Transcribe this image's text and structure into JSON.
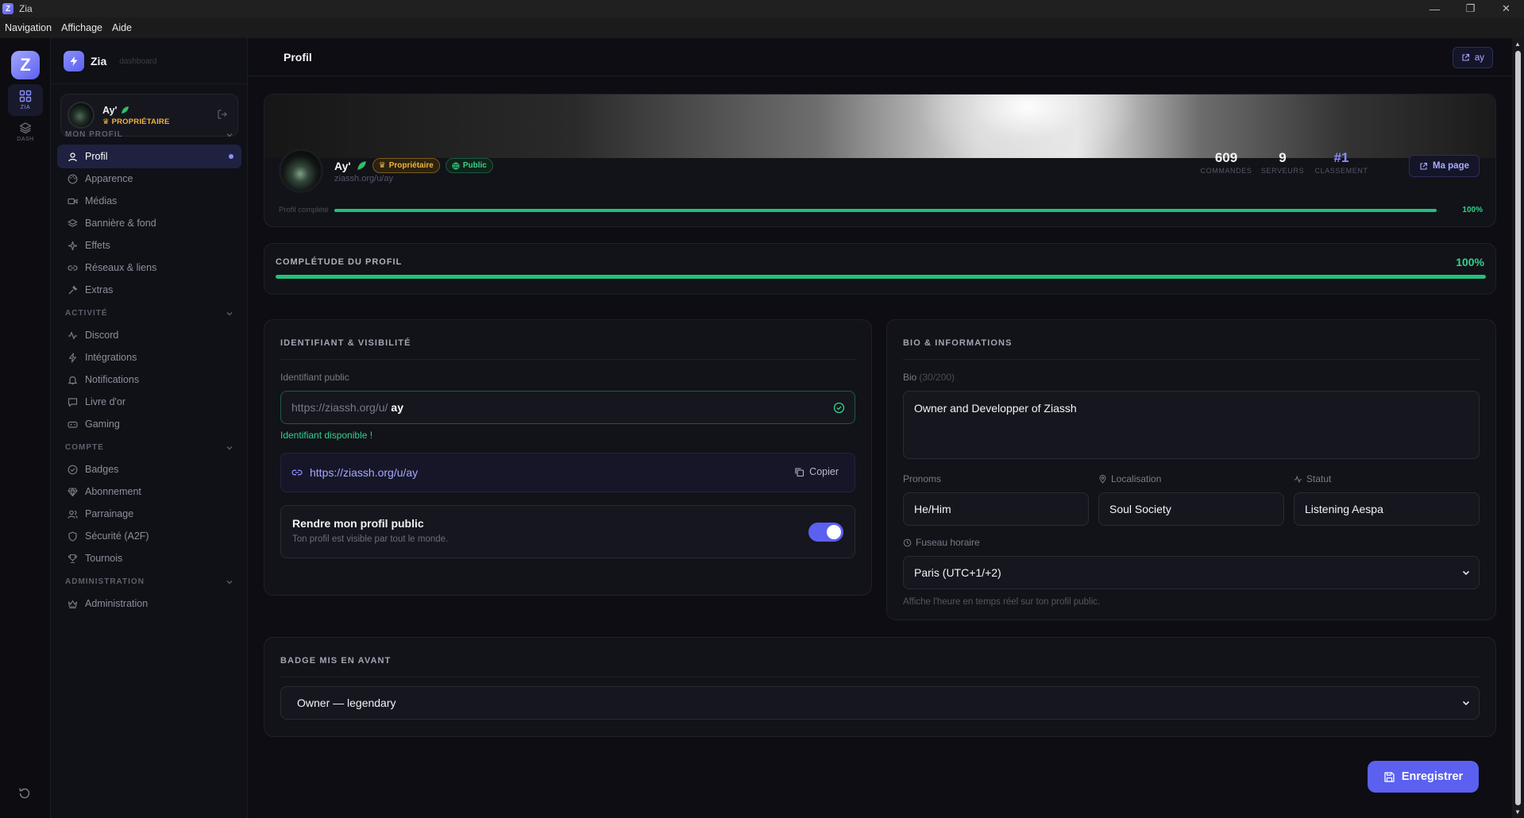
{
  "window": {
    "title": "Zia",
    "minimize": "—",
    "maximize": "❐",
    "close": "✕"
  },
  "menubar": [
    "Navigation",
    "Affichage",
    "Aide"
  ],
  "rail": {
    "logo": "Z",
    "items": [
      {
        "label": "ZIA",
        "icon": "grid-icon"
      },
      {
        "label": "DASH",
        "icon": "layers-icon"
      }
    ]
  },
  "sidebar": {
    "brand": {
      "name": "Zia",
      "sub": "dashboard"
    },
    "user": {
      "name": "Ay'",
      "role": "PROPRIÉTAIRE"
    },
    "sections": [
      {
        "title": "MON PROFIL",
        "items": [
          {
            "label": "Profil",
            "icon": "user-icon",
            "active": true
          },
          {
            "label": "Apparence",
            "icon": "palette-icon"
          },
          {
            "label": "Médias",
            "icon": "video-icon"
          },
          {
            "label": "Bannière & fond",
            "icon": "layers-icon"
          },
          {
            "label": "Effets",
            "icon": "sparkles-icon"
          },
          {
            "label": "Réseaux & liens",
            "icon": "link-icon"
          },
          {
            "label": "Extras",
            "icon": "wrench-icon"
          }
        ]
      },
      {
        "title": "ACTIVITÉ",
        "items": [
          {
            "label": "Discord",
            "icon": "activity-icon"
          },
          {
            "label": "Intégrations",
            "icon": "zap-icon"
          },
          {
            "label": "Notifications",
            "icon": "bell-icon"
          },
          {
            "label": "Livre d'or",
            "icon": "message-icon"
          },
          {
            "label": "Gaming",
            "icon": "gamepad-icon"
          }
        ]
      },
      {
        "title": "COMPTE",
        "items": [
          {
            "label": "Badges",
            "icon": "badge-check-icon"
          },
          {
            "label": "Abonnement",
            "icon": "gem-icon"
          },
          {
            "label": "Parrainage",
            "icon": "users-icon"
          },
          {
            "label": "Sécurité (A2F)",
            "icon": "shield-icon"
          },
          {
            "label": "Tournois",
            "icon": "trophy-icon"
          }
        ]
      },
      {
        "title": "ADMINISTRATION",
        "items": [
          {
            "label": "Administration",
            "icon": "crown-icon"
          }
        ]
      }
    ]
  },
  "topbar": {
    "title": "Profil",
    "pill": "ay"
  },
  "profile": {
    "name": "Ay'",
    "owner_tag": "Propriétaire",
    "public_tag": "Public",
    "url": "ziassh.org/u/ay",
    "stats": [
      {
        "value": "609",
        "label": "COMMANDES"
      },
      {
        "value": "9",
        "label": "SERVEURS"
      },
      {
        "value": "#1",
        "label": "CLASSEMENT"
      }
    ],
    "mapage": "Ma page",
    "completion_label": "Profil complété",
    "completion": 100,
    "completion_text": "100%"
  },
  "completude": {
    "title": "COMPLÉTUDE DU PROFIL",
    "pct": "100%",
    "value": 100
  },
  "identifiant": {
    "title": "IDENTIFIANT & VISIBILITÉ",
    "label": "Identifiant public",
    "prefix": "https://ziassh.org/u/",
    "value": "ay",
    "available": "Identifiant disponible !",
    "link": "https://ziassh.org/u/ay",
    "copy": "Copier",
    "public_title": "Rendre mon profil public",
    "public_desc": "Ton profil est visible par tout le monde.",
    "public_on": true
  },
  "bio": {
    "title": "BIO & INFORMATIONS",
    "label": "Bio",
    "count": "(30/200)",
    "text": "Owner and Developper of Ziassh",
    "pronoms_label": "Pronoms",
    "pronoms": "He/Him",
    "loc_label": "Localisation",
    "loc": "Soul Society",
    "statut_label": "Statut",
    "statut": "Listening Aespa",
    "tz_label": "Fuseau horaire",
    "tz": "Paris (UTC+1/+2)",
    "tz_hint": "Affiche l'heure en temps réel sur ton profil public."
  },
  "badge": {
    "title": "BADGE MIS EN AVANT",
    "value": "Owner — legendary"
  },
  "save": "Enregistrer",
  "colors": {
    "accent": "#5b60f0",
    "success": "#22c07a",
    "gold": "#f2b53c"
  }
}
